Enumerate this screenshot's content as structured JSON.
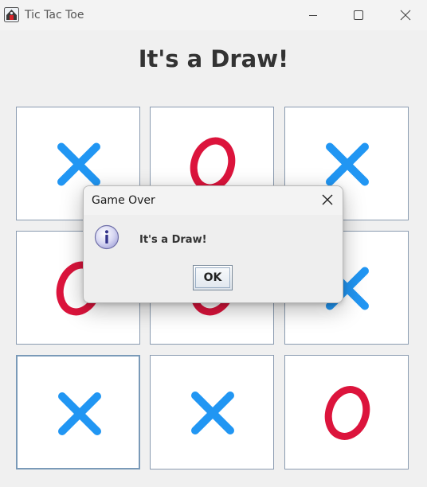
{
  "window": {
    "title": "Tic Tac Toe",
    "app_icon": "tic-tac-toe-app-icon",
    "controls": [
      "minimize-icon",
      "maximize-icon",
      "close-icon"
    ]
  },
  "heading": "It's a Draw!",
  "board": {
    "cells": [
      "X",
      "O",
      "X",
      "O",
      "O",
      "X",
      "X",
      "X",
      "O"
    ],
    "focused_cell": 6,
    "colors": {
      "X": "#2196f3",
      "O": "#dc143c"
    }
  },
  "dialog": {
    "title": "Game Over",
    "message": "It's a Draw!",
    "icon": "info-icon",
    "ok_label": "OK"
  }
}
